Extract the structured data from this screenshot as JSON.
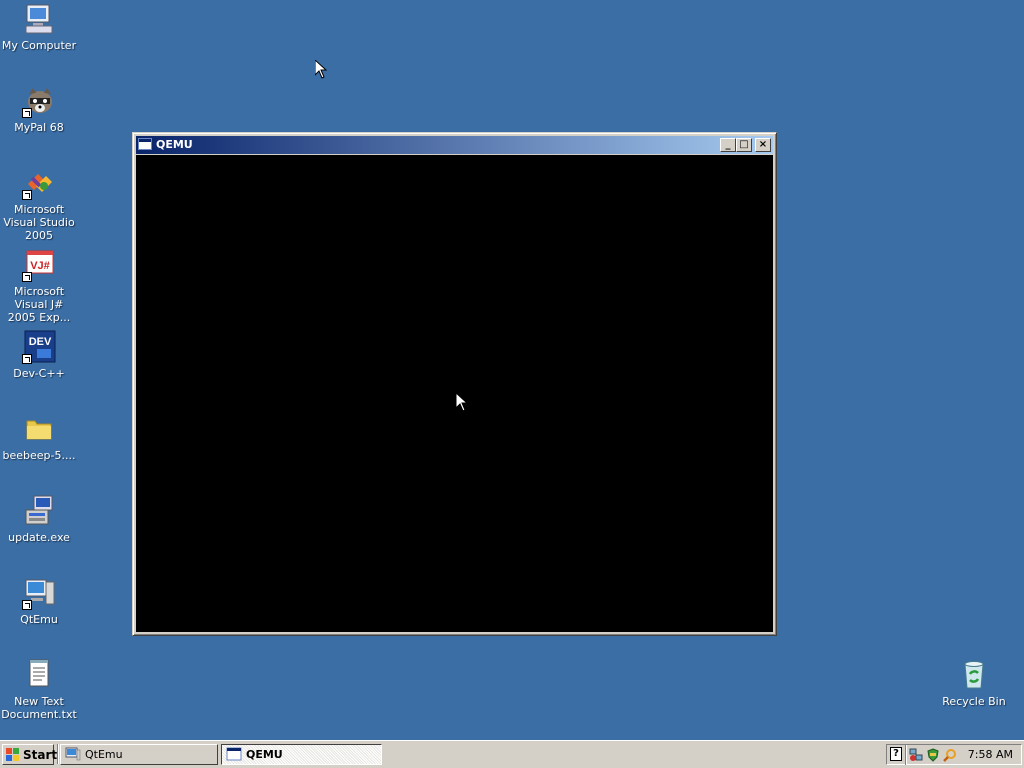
{
  "desktop": {
    "icons": [
      {
        "label": "My Computer",
        "icon": "computer-icon"
      },
      {
        "label": "MyPal 68",
        "icon": "raccoon-browser-icon"
      },
      {
        "label": "Microsoft Visual Studio 2005",
        "icon": "visual-studio-icon"
      },
      {
        "label": "Microsoft Visual J# 2005 Exp...",
        "icon": "vj-sharp-icon"
      },
      {
        "label": "Dev-C++",
        "icon": "dev-cpp-icon"
      },
      {
        "label": "beebeep-5....",
        "icon": "folder-icon"
      },
      {
        "label": "update.exe",
        "icon": "installer-icon"
      },
      {
        "label": "QtEmu",
        "icon": "qtemu-icon"
      },
      {
        "label": "New Text Document.txt",
        "icon": "notepad-document-icon"
      },
      {
        "label": "Recycle Bin",
        "icon": "recycle-bin-icon"
      }
    ],
    "background_color": "#3a6ea5"
  },
  "window": {
    "title": "QEMU",
    "minimize_glyph": "_",
    "maximize_glyph": "□",
    "close_glyph": "×",
    "screen_color": "#000000"
  },
  "taskbar": {
    "start_label": "Start",
    "tasks": [
      {
        "label": "QtEmu",
        "active": false
      },
      {
        "label": "QEMU",
        "active": true
      }
    ],
    "tray_help": "?",
    "clock": "7:58 AM"
  }
}
